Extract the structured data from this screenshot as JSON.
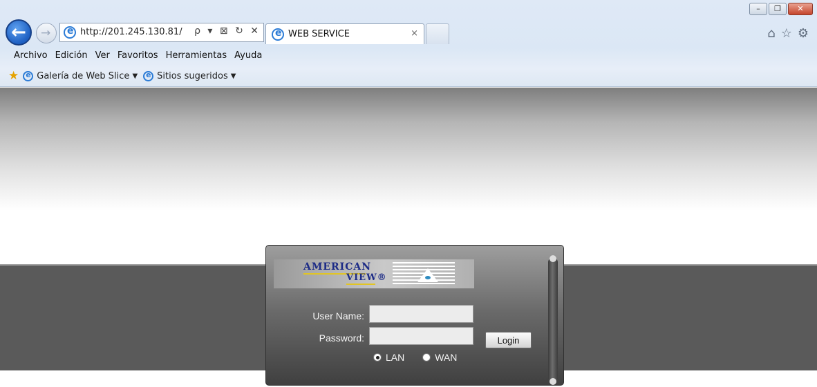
{
  "browser": {
    "address": "http://201.245.130.81/",
    "address_tools": "ρ ▾ ⊠ ↻ ✕",
    "tab_title": "WEB SERVICE",
    "tab_close": "×",
    "window_buttons": {
      "minimize": "–",
      "restore": "❐",
      "close": "✕"
    },
    "icons": [
      "home-icon",
      "favorites-star-icon",
      "tools-gear-icon"
    ],
    "menu": [
      "Archivo",
      "Edición",
      "Ver",
      "Favoritos",
      "Herramientas",
      "Ayuda"
    ],
    "favorites_bar": [
      {
        "label": "Galería de Web Slice",
        "has_dropdown": true
      },
      {
        "label": "Sitios sugeridos",
        "has_dropdown": true
      }
    ]
  },
  "login": {
    "logo_line1": "AMERICAN",
    "logo_line2": "VIEW®",
    "username_label": "User Name:",
    "username_value": "",
    "password_label": "Password:",
    "password_value": "",
    "login_button": "Login",
    "network_options": [
      "LAN",
      "WAN"
    ],
    "selected_network": "LAN"
  },
  "colors": {
    "band": "#5a5a5a",
    "panel_top": "#9e9e9e",
    "panel_bottom": "#3f3f3f",
    "logo_text": "#1c2b86",
    "logo_underline": "#e2c522"
  }
}
